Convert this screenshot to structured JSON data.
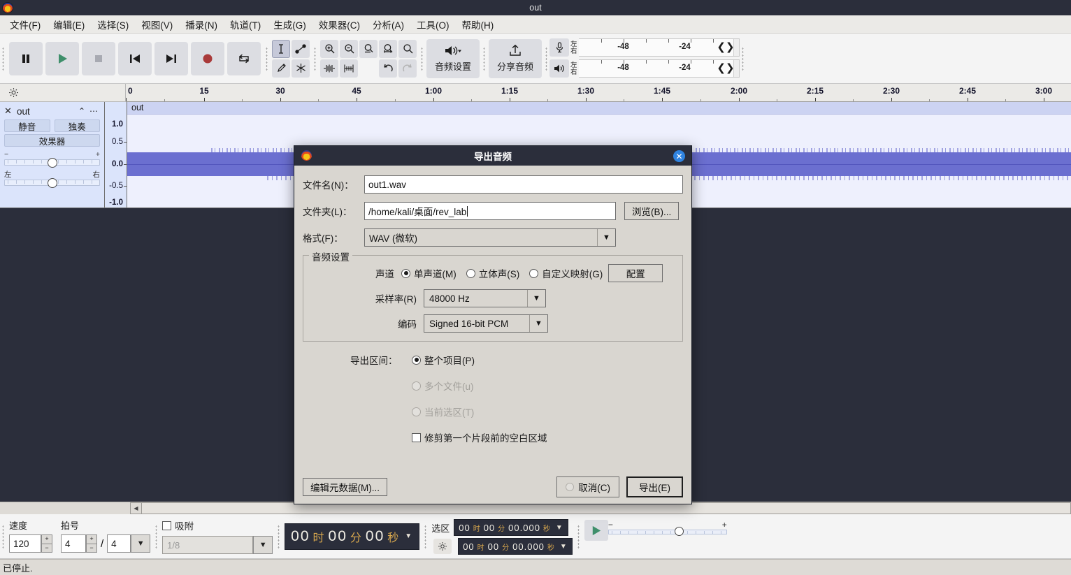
{
  "window": {
    "title": "out",
    "app_icon": "audacity-logo-icon"
  },
  "menubar": {
    "items": [
      {
        "label": "文件(F)"
      },
      {
        "label": "编辑(E)"
      },
      {
        "label": "选择(S)"
      },
      {
        "label": "视图(V)"
      },
      {
        "label": "播录(N)"
      },
      {
        "label": "轨道(T)"
      },
      {
        "label": "生成(G)"
      },
      {
        "label": "效果器(C)"
      },
      {
        "label": "分析(A)"
      },
      {
        "label": "工具(O)"
      },
      {
        "label": "帮助(H)"
      }
    ]
  },
  "toolbar": {
    "transport": [
      {
        "name": "pause-button",
        "icon": "pause-icon"
      },
      {
        "name": "play-button",
        "icon": "play-icon"
      },
      {
        "name": "stop-button",
        "icon": "stop-icon"
      },
      {
        "name": "skip-start-button",
        "icon": "skip-to-start-icon"
      },
      {
        "name": "skip-end-button",
        "icon": "skip-to-end-icon"
      },
      {
        "name": "record-button",
        "icon": "record-icon"
      },
      {
        "name": "loop-button",
        "icon": "loop-icon"
      }
    ],
    "tools": [
      {
        "name": "selection-tool",
        "icon": "i-beam-icon",
        "selected": true
      },
      {
        "name": "envelope-tool",
        "icon": "envelope-icon",
        "selected": false
      },
      {
        "name": "draw-tool",
        "icon": "pencil-icon",
        "selected": false
      },
      {
        "name": "multi-tool",
        "icon": "asterisk-icon",
        "selected": false
      }
    ],
    "zoom_tools": [
      {
        "name": "zoom-in-button",
        "icon": "zoom-in-icon"
      },
      {
        "name": "zoom-out-button",
        "icon": "zoom-out-icon"
      },
      {
        "name": "fit-selection-button",
        "icon": "zoom-fit-selection-icon"
      },
      {
        "name": "fit-project-button",
        "icon": "zoom-fit-project-icon"
      },
      {
        "name": "zoom-toggle-button",
        "icon": "zoom-toggle-icon"
      },
      {
        "name": "trim-audio-button",
        "icon": "trim-outside-selection-icon"
      },
      {
        "name": "silence-audio-button",
        "icon": "silence-selection-icon"
      },
      {
        "name": "undo-button",
        "icon": "undo-icon"
      },
      {
        "name": "redo-button",
        "icon": "redo-icon",
        "disabled": true
      }
    ],
    "audio_setup": {
      "label": "音频设置",
      "icon": "speaker-icon"
    },
    "share_audio": {
      "label": "分享音频",
      "icon": "upload-icon"
    },
    "meters": {
      "record": {
        "icon": "microphone-icon",
        "left_label": "左",
        "right_label": "右"
      },
      "play": {
        "icon": "speaker-icon",
        "left_label": "左",
        "right_label": "右"
      },
      "scale_ticks": [
        "-48",
        "-24"
      ]
    }
  },
  "timeline": {
    "gear_icon": "timeline-options-gear-icon",
    "labels": [
      "0",
      "15",
      "30",
      "45",
      "1:00",
      "1:15",
      "1:30",
      "1:45",
      "2:00",
      "2:15",
      "2:30",
      "2:45",
      "3:00"
    ]
  },
  "track": {
    "close_icon": "close-icon",
    "name": "out",
    "collapse_icon": "chevron-up-icon",
    "menu_icon": "ellipsis-icon",
    "mute_label": "静音",
    "solo_label": "独奏",
    "effects_label": "效果器",
    "gain_minus": "−",
    "gain_plus": "+",
    "pan_left": "左",
    "pan_right": "右",
    "vruler_labels": [
      "1.0",
      "0.5",
      "0.0",
      "-0.5",
      "-1.0"
    ],
    "clip_title": "out"
  },
  "bottom_bar": {
    "tempo_label": "速度",
    "tempo_value": "120",
    "timesig_label": "拍号",
    "timesig_upper": "4",
    "timesig_divider": "/",
    "timesig_lower": "4",
    "snap_label": "吸附",
    "snap_placeholder": "1/8",
    "audio_position": {
      "hours": "00",
      "h_unit": "时",
      "minutes": "00",
      "m_unit": "分",
      "seconds": "00",
      "s_unit": "秒"
    },
    "selection_label": "选区",
    "selection_gear_icon": "selection-options-gear-icon",
    "selection_start": {
      "hours": "00",
      "h_unit": "时",
      "minutes": "00",
      "m_unit": "分",
      "seconds": "00.000",
      "s_unit": "秒"
    },
    "selection_end": {
      "hours": "00",
      "h_unit": "时",
      "minutes": "00",
      "m_unit": "分",
      "seconds": "00.000",
      "s_unit": "秒"
    },
    "play_speed_icon": "play-at-speed-icon",
    "speed_minus": "−",
    "speed_plus": "+"
  },
  "statusbar": {
    "text": "已停止."
  },
  "dialog": {
    "title": "导出音频",
    "icon": "audacity-logo-icon",
    "close_icon": "close-icon",
    "filename_label": "文件名(N)：",
    "filename_value": "out1.wav",
    "folder_label": "文件夹(L)：",
    "folder_value": "/home/kali/桌面/rev_lab",
    "browse_label": "浏览(B)...",
    "format_label": "格式(F)：",
    "format_value": "WAV (微软)",
    "audio_settings": {
      "group_title": "音频设置",
      "channels_label": "声道",
      "channel_options": [
        {
          "label": "单声道(M)",
          "selected": true,
          "disabled": false
        },
        {
          "label": "立体声(S)",
          "selected": false,
          "disabled": false
        },
        {
          "label": "自定义映射(G)",
          "selected": false,
          "disabled": false
        }
      ],
      "configure_label": "配置",
      "samplerate_label": "采样率(R)",
      "samplerate_value": "48000 Hz",
      "encoding_label": "编码",
      "encoding_value": "Signed 16-bit PCM"
    },
    "export_range": {
      "label": "导出区间：",
      "options": [
        {
          "label": "整个项目(P)",
          "selected": true,
          "disabled": false
        },
        {
          "label": "多个文件(u)",
          "selected": false,
          "disabled": true
        },
        {
          "label": "当前选区(T)",
          "selected": false,
          "disabled": true
        }
      ],
      "trim_checkbox_label": "修剪第一个片段前的空白区域",
      "trim_checked": false
    },
    "edit_metadata_label": "编辑元数据(M)...",
    "cancel_label": "取消(C)",
    "export_label": "导出(E)"
  },
  "colors": {
    "titlebar": "#2b2e3b",
    "dialog_bg": "#d9d6d0",
    "track_panel": "#dbe4fb",
    "waveform": "#6b6fd0",
    "accent_blue": "#2f83e0"
  }
}
